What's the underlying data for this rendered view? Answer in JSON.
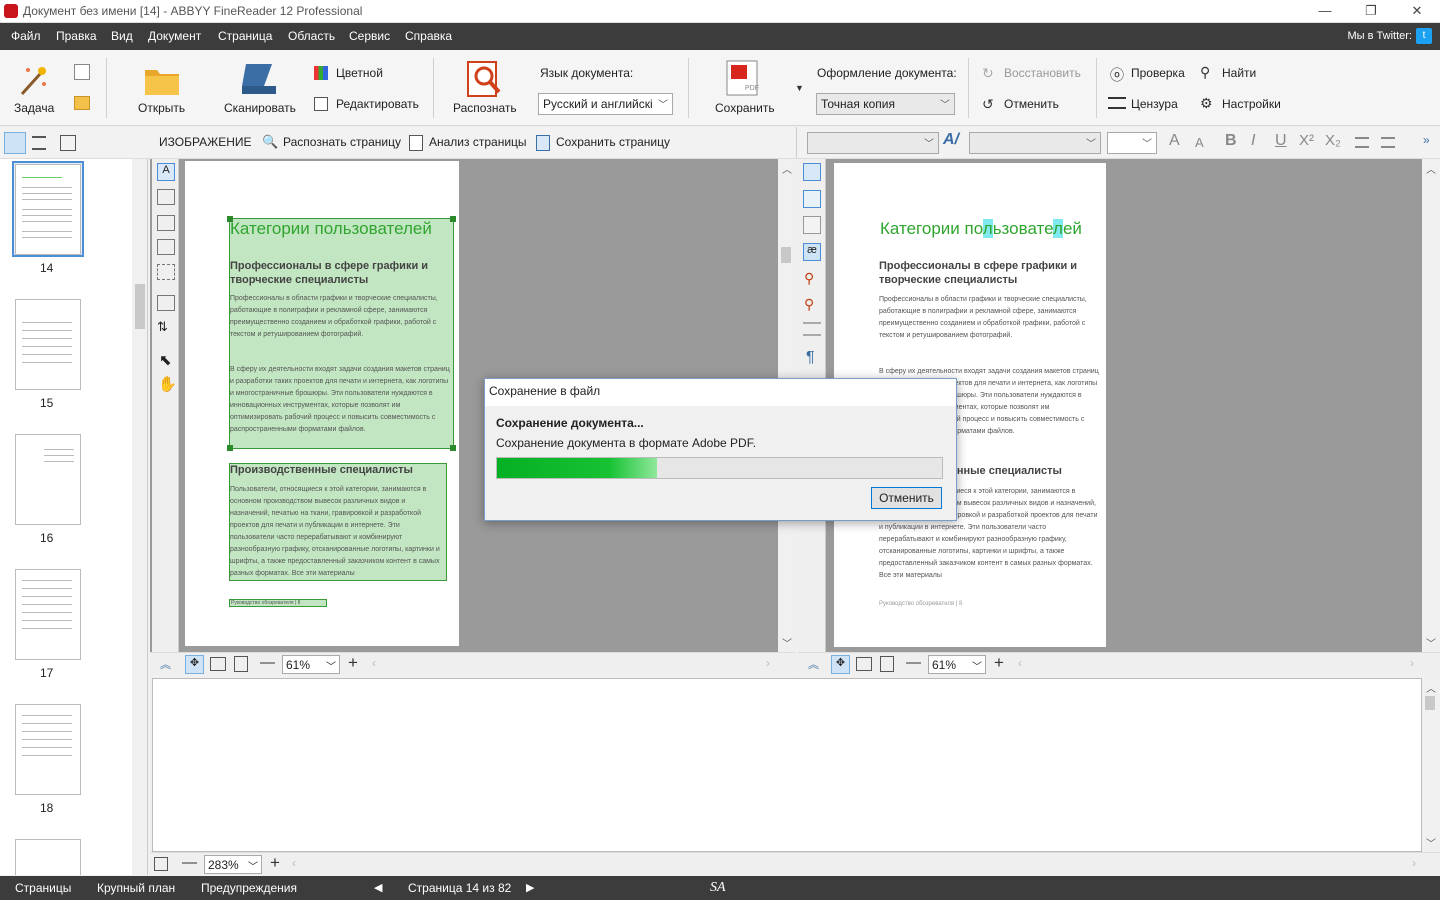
{
  "window": {
    "title": "Документ без имени [14] - ABBYY FineReader 12 Professional",
    "controls": {
      "minimize": "—",
      "restore": "❐",
      "close": "✕"
    }
  },
  "menu": {
    "items": [
      "Файл",
      "Правка",
      "Вид",
      "Документ",
      "Страница",
      "Область",
      "Сервис",
      "Справка"
    ],
    "twitter": "Мы в Twitter:"
  },
  "ribbon": {
    "task": "Задача",
    "open": "Открыть",
    "scan": "Сканировать",
    "color": "Цветной",
    "edit": "Редактировать",
    "recognize": "Распознать",
    "doc_lang_label": "Язык документа:",
    "doc_lang_value": "Русский и английскі",
    "save": "Сохранить",
    "doc_format_label": "Оформление документа:",
    "doc_format_value": "Точная копия",
    "restore": "Восстановить",
    "undo": "Отменить",
    "check": "Проверка",
    "censor": "Цензура",
    "find": "Найти",
    "settings": "Настройки"
  },
  "image_toolbar": {
    "title": "ИЗОБРАЖЕНИЕ",
    "recognize_page": "Распознать страницу",
    "analyze_page": "Анализ страницы",
    "save_page": "Сохранить страницу"
  },
  "text_toolbar": {
    "format_buttons": [
      "A",
      "A",
      "B",
      "I",
      "U",
      "X²",
      "X₂"
    ]
  },
  "thumbnails": {
    "pages": [
      "14",
      "15",
      "16",
      "17",
      "18"
    ]
  },
  "image_page": {
    "heading": "Категории пользователей",
    "subheading": "Профессионалы в сфере графики и творческие специалисты",
    "para1": "Профессионалы в области графики и творческие специалисты, работающие в полиграфии и рекламной сфере, занимаются преимущественно созданием и обработкой графики, работой с текстом и ретушированием фотографий.",
    "para2": "В сферу их деятельности входят задачи создания макетов страниц и разработки таких проектов для печати и интернета, как логотипы и многостраничные брошюры. Эти пользователи нуждаются в инновационных инструментах, которые позволят им оптимизировать рабочий процесс и повысить совместимость с распространенными форматами файлов.",
    "heading2": "Производственные специалисты",
    "para3": "Пользователи, относящиеся к этой категории, занимаются в основном производством вывесок различных видов и назначений, печатью на ткани, гравировкой и разработкой проектов для печати и публикации в интернете. Эти пользователи часто перерабатывают и комбинируют разнообразную графику, отсканированные логотипы, картинки и шрифты, а также предоставленный заказчиком контент в самых разных форматах. Все эти материалы",
    "footer": "Руководство обозревателя | 8"
  },
  "text_page": {
    "heading_parts": [
      "Категории по",
      "л",
      "ьзовате",
      "л",
      "ей"
    ],
    "subheading": "Профессионалы в сфере графики и творческие специалисты",
    "para1": "Профессионалы в области графики и творческие специалисты, работающие в полиграфии и рекламной сфере, занимаются преимущественно созданием и обработкой графики, работой с текстом и ретушированием фотографий.",
    "para2": "В сферу их деятельности входят задачи создания макетов страниц и разработки таких проектов для печати и интернета, как логотипы и многостраничные брошюры. Эти пользователи нуждаются в инновационных инструментах, которые позволят им оптимизировать рабочий процесс и повысить совместимость с распространенными форматами файлов.",
    "heading2": "Производственные специалисты",
    "para3": "Пользователи, относящиеся к этой категории, занимаются в основном производством вывесок различных видов и назначений, печатью на ткани, гравировкой и разработкой проектов для печати и публикации в интернете. Эти пользователи часто перерабатывают и комбинируют разнообразную графику, отсканированные логотипы, картинки и шрифты, а также предоставленный заказчиком контент в самых разных форматах. Все эти материалы",
    "footer": "Руководство обозревателя | 8"
  },
  "zoom": {
    "image": "61%",
    "text": "61%",
    "closeup": "283%"
  },
  "dialog": {
    "title": "Сохранение в файл",
    "heading": "Сохранение документа...",
    "message": "Сохранение документа в формате Adobe PDF.",
    "progress": 0.36,
    "cancel": "Отменить"
  },
  "status": {
    "pages": "Страницы",
    "closeup": "Крупный план",
    "warnings": "Предупреждения",
    "page_info": "Страница 14 из 82",
    "sa": "SA"
  },
  "colors": {
    "menubar": "#3c3c3c",
    "ocr_green": "#3a9a3a",
    "progress": "#06b025",
    "heading_green": "#2fa52f",
    "accent_blue": "#0078d7"
  }
}
